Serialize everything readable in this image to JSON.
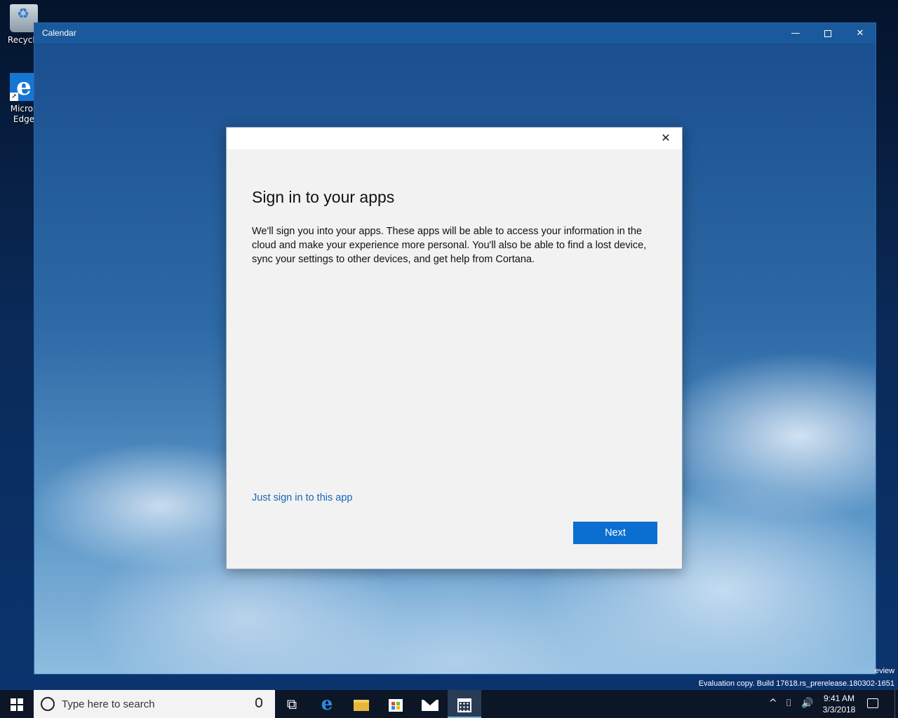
{
  "desktop": {
    "icons": [
      {
        "label": "Recycle"
      },
      {
        "label": "Micros Edge"
      }
    ]
  },
  "window": {
    "title": "Calendar",
    "controls": {
      "minimize": "—",
      "close": "✕"
    }
  },
  "dialog": {
    "close": "✕",
    "title": "Sign in to your apps",
    "body": "We'll sign you into your apps. These apps will be able to access your information in the cloud and make your experience more personal. You'll also be able to find a lost device, sync your settings to other devices, and get help from Cortana.",
    "link": "Just sign in to this app",
    "next_label": "Next",
    "accent": "#0a6fd0"
  },
  "watermark": {
    "preview": "eview",
    "build": "Evaluation copy. Build 17618.rs_prerelease.180302-1651"
  },
  "taskbar": {
    "search_placeholder": "Type here to search",
    "edge_glyph": "e",
    "tray": {
      "chevron": "^",
      "network": "⌷",
      "volume": "🔊"
    },
    "time": "9:41 AM",
    "date": "3/3/2018"
  }
}
